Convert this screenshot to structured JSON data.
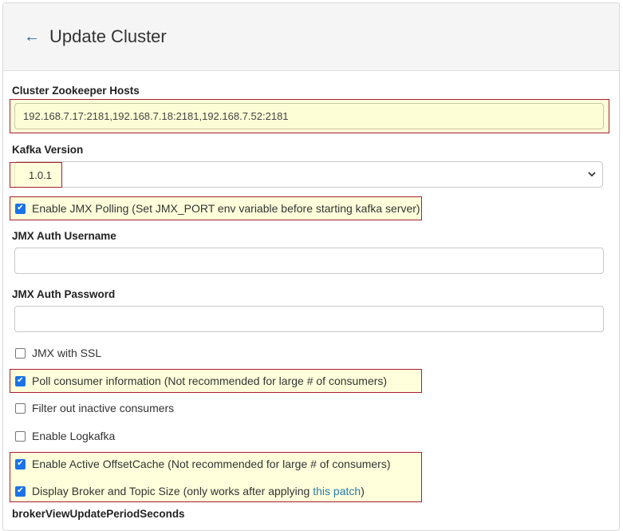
{
  "header": {
    "back_icon": "back-arrow-icon",
    "title": "Update Cluster"
  },
  "form": {
    "zk_hosts": {
      "label": "Cluster Zookeeper Hosts",
      "value": "192.168.7.17:2181,192.168.7.18:2181,192.168.7.52:2181"
    },
    "kafka_version": {
      "label": "Kafka Version",
      "value": "1.0.1"
    },
    "jmx_polling": {
      "label": "Enable JMX Polling (Set JMX_PORT env variable before starting kafka server)",
      "checked": true
    },
    "jmx_user": {
      "label": "JMX Auth Username",
      "value": ""
    },
    "jmx_pass": {
      "label": "JMX Auth Password",
      "value": ""
    },
    "jmx_ssl": {
      "label": "JMX with SSL",
      "checked": false
    },
    "poll_consumer": {
      "label": "Poll consumer information (Not recommended for large # of consumers)",
      "checked": true
    },
    "filter_inactive": {
      "label": "Filter out inactive consumers",
      "checked": false
    },
    "logkafka": {
      "label": "Enable Logkafka",
      "checked": false
    },
    "offset_cache": {
      "label": "Enable Active OffsetCache (Not recommended for large # of consumers)",
      "checked": true
    },
    "broker_topic_size": {
      "label_prefix": "Display Broker and Topic Size (only works after applying ",
      "link": "this patch",
      "label_suffix": ")",
      "checked": true
    },
    "next_label": "brokerViewUpdatePeriodSeconds"
  },
  "colors": {
    "highlight_border": "#a42030",
    "highlight_fill": "#ffffbe",
    "checkbox": "#1a73e8",
    "link": "#2a7ab0"
  }
}
